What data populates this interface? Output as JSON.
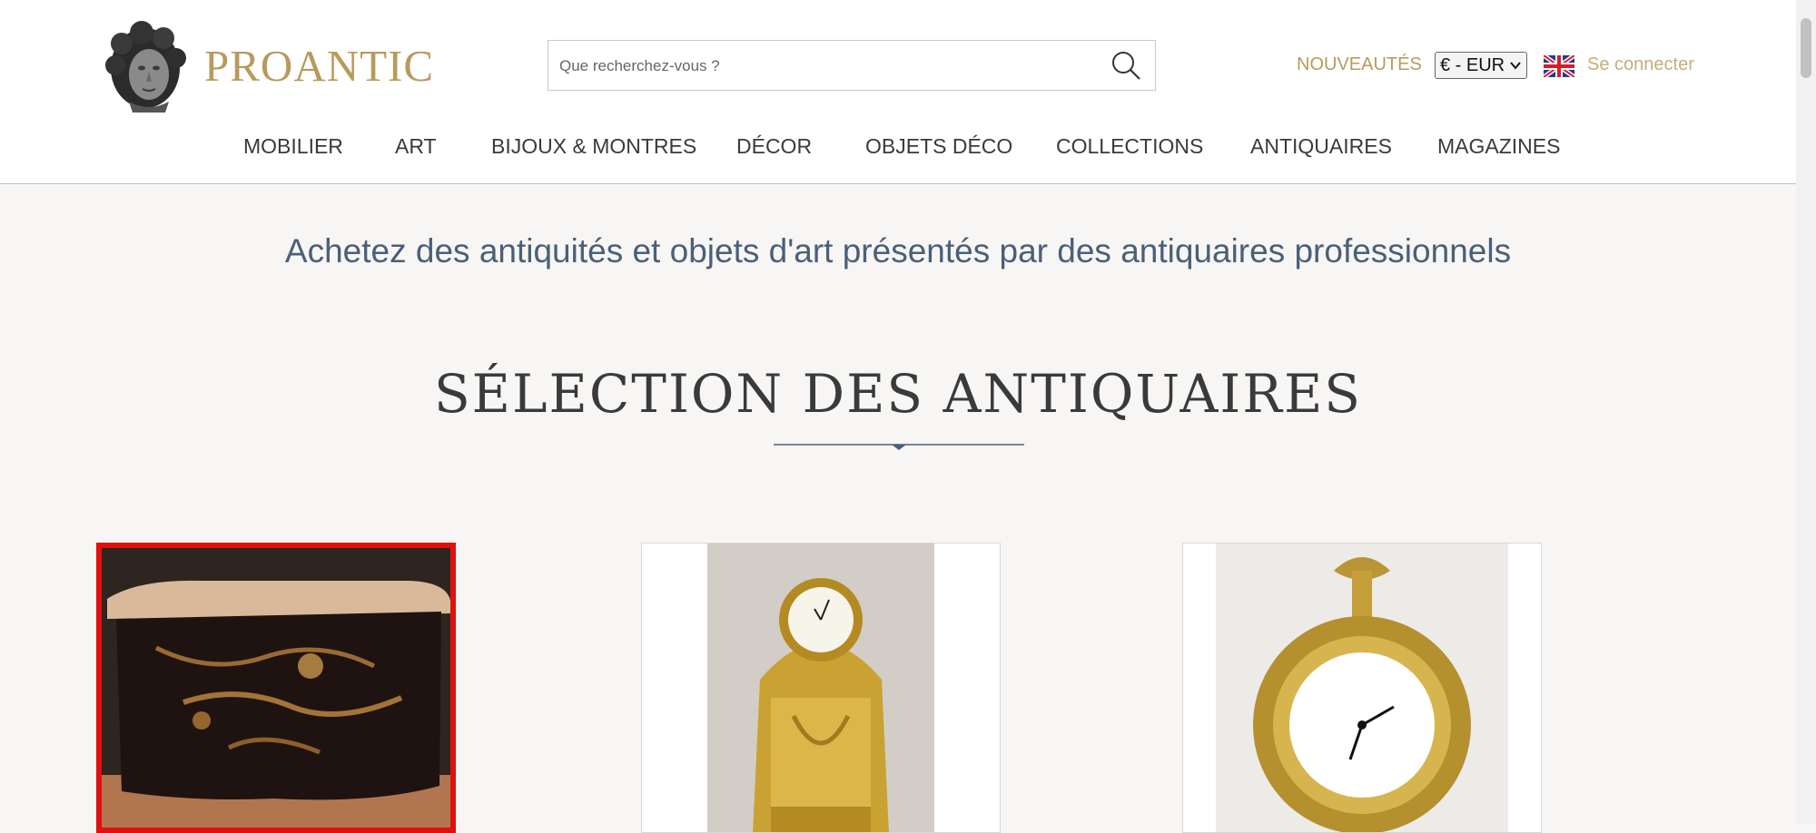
{
  "header": {
    "brand": "PROANTIC",
    "search_placeholder": "Que recherchez-vous ?",
    "nouveautes": "NOUVEAUTÉS",
    "currency": "€ - EUR",
    "login": "Se connecter"
  },
  "nav": {
    "items": [
      "MOBILIER",
      "ART",
      "BIJOUX & MONTRES",
      "DÉCOR",
      "OBJETS DÉCO",
      "COLLECTIONS",
      "ANTIQUAIRES",
      "MAGAZINES"
    ]
  },
  "main": {
    "tagline": "Achetez des antiquités et objets d'art présentés par des antiquaires professionnels",
    "section_title": "SÉLECTION DES ANTIQUAIRES"
  },
  "colors": {
    "accent_gold": "#b89a5b",
    "tagline_blue": "#4b5f78",
    "selection_red": "#e0100f"
  }
}
